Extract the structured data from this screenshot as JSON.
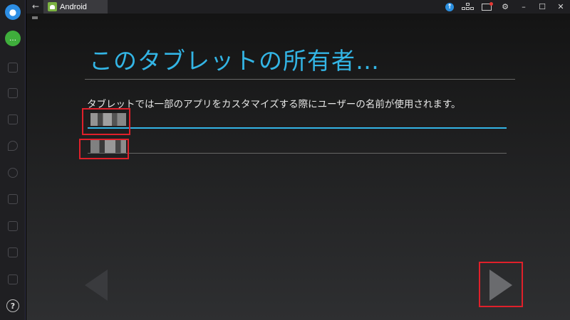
{
  "titlebar": {
    "tab_label": "Android",
    "icons": [
      "back-arrow-icon",
      "android-icon",
      "upload-icon",
      "keyboard-keys-icon",
      "mail-icon",
      "gear-icon",
      "minimize-icon",
      "maximize-icon",
      "close-icon"
    ],
    "back_glyph": "←",
    "up_glyph": "↑",
    "gear_glyph": "⚙",
    "min_glyph": "–",
    "max_glyph": "☐",
    "close_glyph": "✕"
  },
  "sidebar": {
    "icons": [
      "video-camera-icon",
      "chat-icon",
      "multi-window-icon",
      "rotate-icon",
      "screenshot-icon",
      "location-icon",
      "more-icon",
      "folder-icon",
      "copy-icon",
      "paste-icon",
      "volume-icon",
      "help-icon"
    ],
    "help_glyph": "?"
  },
  "setup": {
    "title": "このタブレットの所有者…",
    "description": "タブレットでは一部のアプリをカスタマイズする際にユーザーの名前が使用されます。",
    "first_name_value": "",
    "last_name_value": ""
  },
  "colors": {
    "accent": "#33b5e5",
    "highlight": "#e0202a"
  }
}
